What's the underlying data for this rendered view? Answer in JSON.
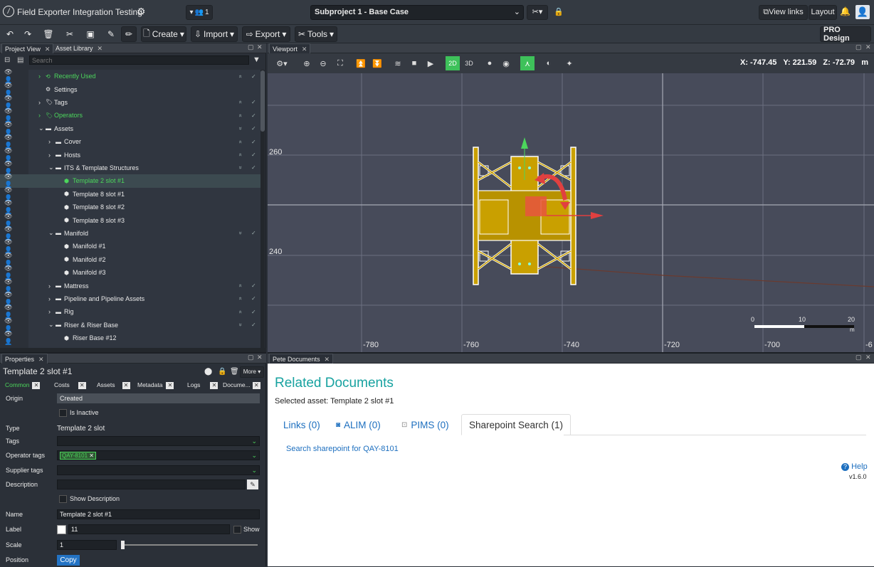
{
  "app": {
    "title": "Field Exporter Integration Testing",
    "project_select": "Subproject 1 - Base Case",
    "users_count": "1",
    "view_links": "View links",
    "layout": "Layout",
    "pro_design": "PRO Design"
  },
  "toolbar": {
    "create": "Create",
    "import": "Import",
    "export": "Export",
    "tools": "Tools"
  },
  "left_panel": {
    "tabs": [
      "Project View",
      "Asset Library"
    ],
    "search_placeholder": "Search",
    "tree": [
      {
        "label": "Recently Used",
        "level": 1,
        "green": true,
        "expander": ">"
      },
      {
        "label": "Settings",
        "level": 1,
        "green": false,
        "expander": ""
      },
      {
        "label": "Tags",
        "level": 1,
        "green": false,
        "expander": ">"
      },
      {
        "label": "Operators",
        "level": 1,
        "green": true,
        "expander": ">"
      },
      {
        "label": "Assets",
        "level": 1,
        "green": false,
        "expander": "v"
      },
      {
        "label": "Cover",
        "level": 2,
        "green": false,
        "expander": ">"
      },
      {
        "label": "Hosts",
        "level": 2,
        "green": false,
        "expander": ">"
      },
      {
        "label": "ITS & Template Structures",
        "level": 2,
        "green": false,
        "expander": "v"
      },
      {
        "label": "Template 2 slot #1",
        "level": 3,
        "green": true,
        "expander": "",
        "selected": true
      },
      {
        "label": "Template 8 slot #1",
        "level": 3,
        "green": false,
        "expander": ""
      },
      {
        "label": "Template 8 slot #2",
        "level": 3,
        "green": false,
        "expander": ""
      },
      {
        "label": "Template 8 slot #3",
        "level": 3,
        "green": false,
        "expander": ""
      },
      {
        "label": "Manifold",
        "level": 2,
        "green": false,
        "expander": "v"
      },
      {
        "label": "Manifold #1",
        "level": 3,
        "green": false,
        "expander": ""
      },
      {
        "label": "Manifold #2",
        "level": 3,
        "green": false,
        "expander": ""
      },
      {
        "label": "Manifold #3",
        "level": 3,
        "green": false,
        "expander": ""
      },
      {
        "label": "Mattress",
        "level": 2,
        "green": false,
        "expander": ">"
      },
      {
        "label": "Pipeline and Pipeline Assets",
        "level": 2,
        "green": false,
        "expander": ">"
      },
      {
        "label": "Rig",
        "level": 2,
        "green": false,
        "expander": ">"
      },
      {
        "label": "Riser & Riser Base",
        "level": 2,
        "green": false,
        "expander": "v"
      },
      {
        "label": "Riser Base #12",
        "level": 3,
        "green": false,
        "expander": ""
      }
    ]
  },
  "properties": {
    "tab": "Properties",
    "title": "Template 2 slot #1",
    "more": "More",
    "subtabs": [
      "Common",
      "Costs",
      "Assets",
      "Metadata",
      "Logs",
      "Docume..."
    ],
    "origin_label": "Origin",
    "origin_value": "Created",
    "is_inactive": "Is Inactive",
    "type_label": "Type",
    "type_value": "Template 2 slot",
    "tags_label": "Tags",
    "operator_tags_label": "Operator tags",
    "operator_tag": "QAY-8101",
    "supplier_tags_label": "Supplier tags",
    "description_label": "Description",
    "show_description": "Show Description",
    "name_label": "Name",
    "name_value": "Template 2 slot #1",
    "label_label": "Label",
    "label_value": "11",
    "show": "Show",
    "scale_label": "Scale",
    "scale_value": "1",
    "position_label": "Position",
    "copy": "Copy"
  },
  "viewport": {
    "tab": "Viewport",
    "mode_2d": "2D",
    "mode_3d": "3D",
    "coord_x": "X: -747.45",
    "coord_y": "Y: 221.59",
    "coord_z": "Z: -72.79",
    "coord_unit": "m",
    "y_ticks": [
      "260",
      "240"
    ],
    "x_ticks": [
      "-780",
      "-760",
      "-740",
      "-720",
      "-700",
      "-6"
    ],
    "scale_labels": [
      "0",
      "10",
      "20"
    ],
    "scale_unit": "m"
  },
  "docs": {
    "tab": "Pete Documents",
    "heading": "Related Documents",
    "selected": "Selected asset: Template 2 slot #1",
    "tabs": [
      "Links (0)",
      "ALIM (0)",
      "PIMS (0)",
      "Sharepoint Search (1)"
    ],
    "search_link": "Search sharepoint for QAY-8101",
    "help": "Help",
    "version": "v1.6.0"
  },
  "colors": {
    "accent_green": "#3ec15a",
    "link_blue": "#1d6fbf",
    "heading_teal": "#17a2a0",
    "structure_yellow": "#c9a000"
  }
}
